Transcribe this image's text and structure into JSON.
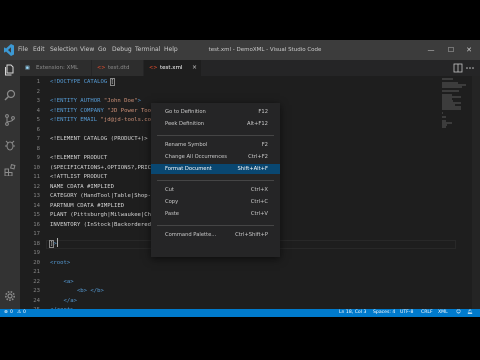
{
  "app": {
    "menu": [
      "File",
      "Edit",
      "Selection",
      "View",
      "Go",
      "Debug",
      "Terminal",
      "Help"
    ],
    "window_title": "test.xml - DemoXML - Visual Studio Code",
    "window_controls": {
      "minimize": "—",
      "maximize": "☐",
      "close": "✕"
    }
  },
  "colors": {
    "accent": "#007acc",
    "menu_highlight": "#094771",
    "editor_bg": "#1e1e1e"
  },
  "activity_icons": [
    "files-icon",
    "search-icon",
    "source-control-icon",
    "debug-icon",
    "extensions-icon",
    "gear-icon"
  ],
  "tabs": [
    {
      "label": "Extension: XML",
      "icon": "extension-icon",
      "active": false
    },
    {
      "label": "test.dtd",
      "icon": "xml-file-icon",
      "active": false
    },
    {
      "label": "test.xml",
      "icon": "xml-file-icon",
      "active": true,
      "close": "×"
    }
  ],
  "editor": {
    "lines": [
      {
        "n": "1",
        "parts": [
          [
            "t",
            "<!"
          ],
          [
            "t",
            "DOCTYPE CATALOG "
          ],
          [
            "b",
            "["
          ]
        ]
      },
      {
        "n": "2",
        "parts": []
      },
      {
        "n": "3",
        "parts": [
          [
            "t",
            "<!ENTITY AUTHOR "
          ],
          [
            "s",
            "\"John Doe\""
          ],
          [
            "t",
            ">"
          ]
        ]
      },
      {
        "n": "4",
        "parts": [
          [
            "t",
            "<!ENTITY COMPANY "
          ],
          [
            "s",
            "\"JD Power Tools, Inc.\""
          ],
          [
            "t",
            ">"
          ]
        ]
      },
      {
        "n": "5",
        "parts": [
          [
            "t",
            "<!ENTITY EMAIL "
          ],
          [
            "s",
            "\"jd@jd-tools.com\""
          ],
          [
            "t",
            ">"
          ]
        ]
      },
      {
        "n": "6",
        "parts": []
      },
      {
        "n": "7",
        "parts": [
          [
            "x",
            "<!ELEMENT CATALOG (PRODUCT+)>"
          ]
        ]
      },
      {
        "n": "8",
        "parts": []
      },
      {
        "n": "9",
        "parts": [
          [
            "x",
            "<!ELEMENT PRODUCT"
          ]
        ]
      },
      {
        "n": "10",
        "parts": [
          [
            "x",
            "(SPECIFICATIONS+,OPTIONS?,PRICE"
          ]
        ]
      },
      {
        "n": "11",
        "parts": [
          [
            "x",
            "<!ATTLIST PRODUCT"
          ]
        ]
      },
      {
        "n": "12",
        "parts": [
          [
            "x",
            "NAME CDATA #IMPLIED"
          ]
        ]
      },
      {
        "n": "13",
        "parts": [
          [
            "x",
            "CATEGORY (HandTool|Table|Shop-P"
          ]
        ]
      },
      {
        "n": "14",
        "parts": [
          [
            "x",
            "PARTNUM CDATA #IMPLIED"
          ]
        ]
      },
      {
        "n": "15",
        "parts": [
          [
            "x",
            "PLANT (Pittsburgh|Milwaukee|Chi"
          ]
        ]
      },
      {
        "n": "16",
        "parts": [
          [
            "x",
            "INVENTORY (InStock|Backordered|"
          ]
        ]
      },
      {
        "n": "17",
        "parts": []
      },
      {
        "n": "18",
        "parts": [
          [
            "b",
            "]"
          ],
          [
            "t",
            ">"
          ]
        ]
      },
      {
        "n": "19",
        "parts": []
      },
      {
        "n": "20",
        "parts": [
          [
            "t",
            "<root>"
          ]
        ]
      },
      {
        "n": "21",
        "parts": []
      },
      {
        "n": "22",
        "parts": [
          [
            "t",
            "    <a>"
          ]
        ]
      },
      {
        "n": "23",
        "parts": [
          [
            "t",
            "        <b> </b>"
          ]
        ]
      },
      {
        "n": "24",
        "parts": [
          [
            "t",
            "    </a>"
          ]
        ]
      },
      {
        "n": "25",
        "parts": [
          [
            "t",
            "</root>"
          ]
        ]
      },
      {
        "n": "26",
        "parts": []
      }
    ]
  },
  "context_menu": {
    "items": [
      {
        "label": "Go to Definition",
        "shortcut": "F12"
      },
      {
        "label": "Peek Definition",
        "shortcut": "Alt+F12"
      },
      {
        "sep": true
      },
      {
        "label": "Rename Symbol",
        "shortcut": "F2"
      },
      {
        "label": "Change All Occurrences",
        "shortcut": "Ctrl+F2"
      },
      {
        "label": "Format Document",
        "shortcut": "Shift+Alt+F",
        "highlighted": true
      },
      {
        "sep": true
      },
      {
        "label": "Cut",
        "shortcut": "Ctrl+X"
      },
      {
        "label": "Copy",
        "shortcut": "Ctrl+C"
      },
      {
        "label": "Paste",
        "shortcut": "Ctrl+V"
      },
      {
        "sep": true
      },
      {
        "label": "Command Palette...",
        "shortcut": "Ctrl+Shift+P"
      }
    ]
  },
  "statusbar": {
    "errors": "0",
    "warnings": "0",
    "position": "Ln 18, Col 3",
    "spaces": "Spaces: 4",
    "encoding": "UTF-8",
    "eol": "CRLF",
    "language": "XML"
  }
}
